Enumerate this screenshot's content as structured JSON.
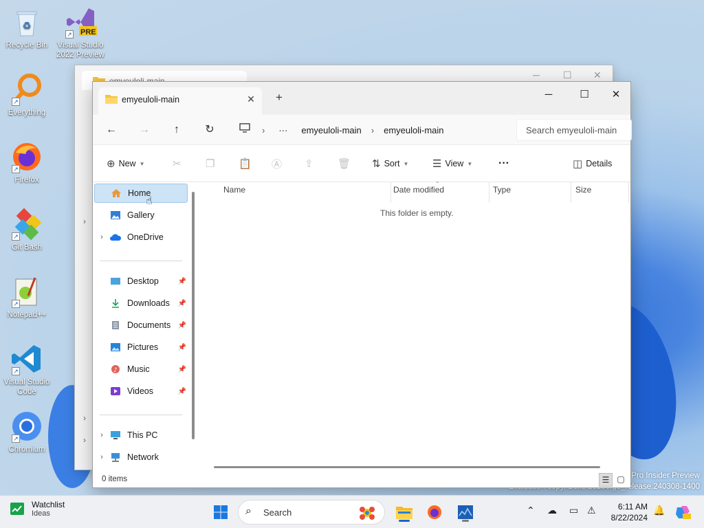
{
  "desktop": {
    "icons": [
      {
        "label": "Recycle Bin"
      },
      {
        "label": "Visual Studio 2022 Preview",
        "badge": "PRE"
      },
      {
        "label": "Everything"
      },
      {
        "label": "Firefox"
      },
      {
        "label": "Git Bash"
      },
      {
        "label": "Notepad++"
      },
      {
        "label": "Visual Studio Code"
      },
      {
        "label": "Chromium"
      }
    ],
    "watermark": {
      "line1": "Pro Insider Preview",
      "line2": "Evaluation copy. Build 26100.ge_release.240308-1400"
    }
  },
  "back_window": {
    "tab_title": "emyeuloli-main"
  },
  "window": {
    "tab_title": "emyeuloli-main",
    "controls": {
      "minimize": "─",
      "maximize": "☐",
      "close": "✕"
    },
    "address": {
      "more": "···",
      "crumbs": [
        "emyeuloli-main",
        "emyeuloli-main"
      ],
      "search_placeholder": "Search emyeuloli-main"
    },
    "toolbar": {
      "new_label": "New",
      "sort_label": "Sort",
      "view_label": "View",
      "more_label": "···",
      "details_label": "Details"
    },
    "nav": {
      "items": [
        {
          "label": "Home",
          "icon": "home-icon",
          "selected": true
        },
        {
          "label": "Gallery",
          "icon": "gallery-icon"
        },
        {
          "label": "OneDrive",
          "icon": "onedrive-icon",
          "expandable": true
        },
        {
          "label": "Desktop",
          "icon": "desktop-icon",
          "pinned": true
        },
        {
          "label": "Downloads",
          "icon": "downloads-icon",
          "pinned": true
        },
        {
          "label": "Documents",
          "icon": "documents-icon",
          "pinned": true
        },
        {
          "label": "Pictures",
          "icon": "pictures-icon",
          "pinned": true
        },
        {
          "label": "Music",
          "icon": "music-icon",
          "pinned": true
        },
        {
          "label": "Videos",
          "icon": "videos-icon",
          "pinned": true
        },
        {
          "label": "This PC",
          "icon": "this-pc-icon",
          "expandable": true
        },
        {
          "label": "Network",
          "icon": "network-icon",
          "expandable": true
        }
      ]
    },
    "columns": [
      "Name",
      "Date modified",
      "Type",
      "Size"
    ],
    "empty_message": "This folder is empty.",
    "status": {
      "item_count": "0 items"
    }
  },
  "taskbar": {
    "widget": {
      "title": "Watchlist",
      "subtitle": "Ideas"
    },
    "search_label": "Search",
    "clock": {
      "time": "6:11 AM",
      "date": "8/22/2024"
    }
  },
  "colors": {
    "accent": "#0067c0",
    "selection": "#cde4f7",
    "taskbar": "#eef0f4"
  }
}
